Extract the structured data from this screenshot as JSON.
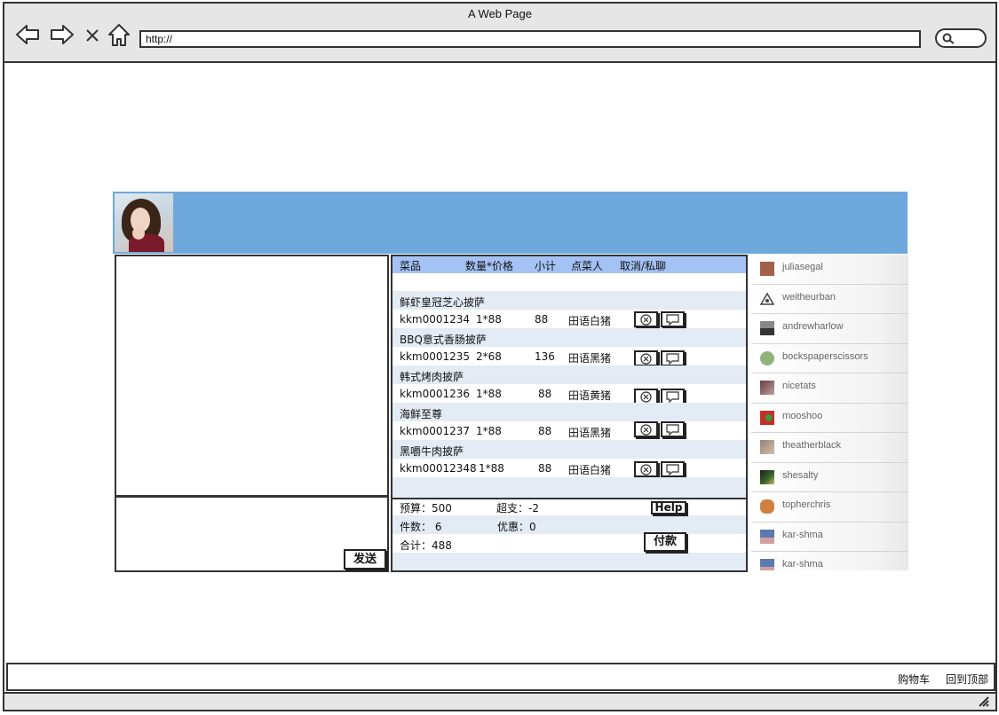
{
  "browser": {
    "title": "A Web Page",
    "url": "http://"
  },
  "order": {
    "headers": {
      "item": "菜品",
      "qty_price": "数量*价格",
      "subtotal": "小计",
      "orderer": "点菜人",
      "action": "取消/私聊"
    },
    "items": [
      {
        "name": "鲜虾皇冠芝心披萨",
        "code": "kkm0001234",
        "qty_price": "1*88",
        "subtotal": "88",
        "orderer": "田语白猪"
      },
      {
        "name": "BBQ意式香肠披萨",
        "code": "kkm0001235",
        "qty_price": "2*68",
        "subtotal": "136",
        "orderer": "田语黑猪"
      },
      {
        "name": "韩式烤肉披萨",
        "code": "kkm0001236",
        "qty_price": "1*88",
        "subtotal": "88",
        "orderer": "田语黄猪"
      },
      {
        "name": "海鲜至尊",
        "code": "kkm0001237",
        "qty_price": "1*88",
        "subtotal": "88",
        "orderer": "田语黑猪"
      },
      {
        "name": "黑嚼牛肉披萨",
        "code": "kkm00012348",
        "qty_price": "1*88",
        "subtotal": "88",
        "orderer": "田语白猪"
      }
    ],
    "summary": {
      "budget": "预算：500",
      "over": "超支：-2",
      "count": "件数：  6",
      "discount": "优惠：0",
      "total": "合计：488"
    },
    "help_label": "Help",
    "pay_label": "付款"
  },
  "chat": {
    "send_label": "发送"
  },
  "users": [
    {
      "name": "juliasegal",
      "color": "#a0604a"
    },
    {
      "name": "weitheurban",
      "color": "#444444"
    },
    {
      "name": "andrewharlow",
      "color": "#555555"
    },
    {
      "name": "bockspaperscissors",
      "color": "#8fb37a"
    },
    {
      "name": "nicetats",
      "color": "#6a3a3a"
    },
    {
      "name": "mooshoo",
      "color": "#c0302a"
    },
    {
      "name": "theatherblack",
      "color": "#9a8070"
    },
    {
      "name": "shesalty",
      "color": "#3a6a2a"
    },
    {
      "name": "topherchris",
      "color": "#d08040"
    },
    {
      "name": "kar-shma",
      "color": "#5a7ab0"
    },
    {
      "name": "kar-shma",
      "color": "#5a7ab0"
    }
  ],
  "footer": {
    "cart": "购物车",
    "top": "回到顶部"
  }
}
